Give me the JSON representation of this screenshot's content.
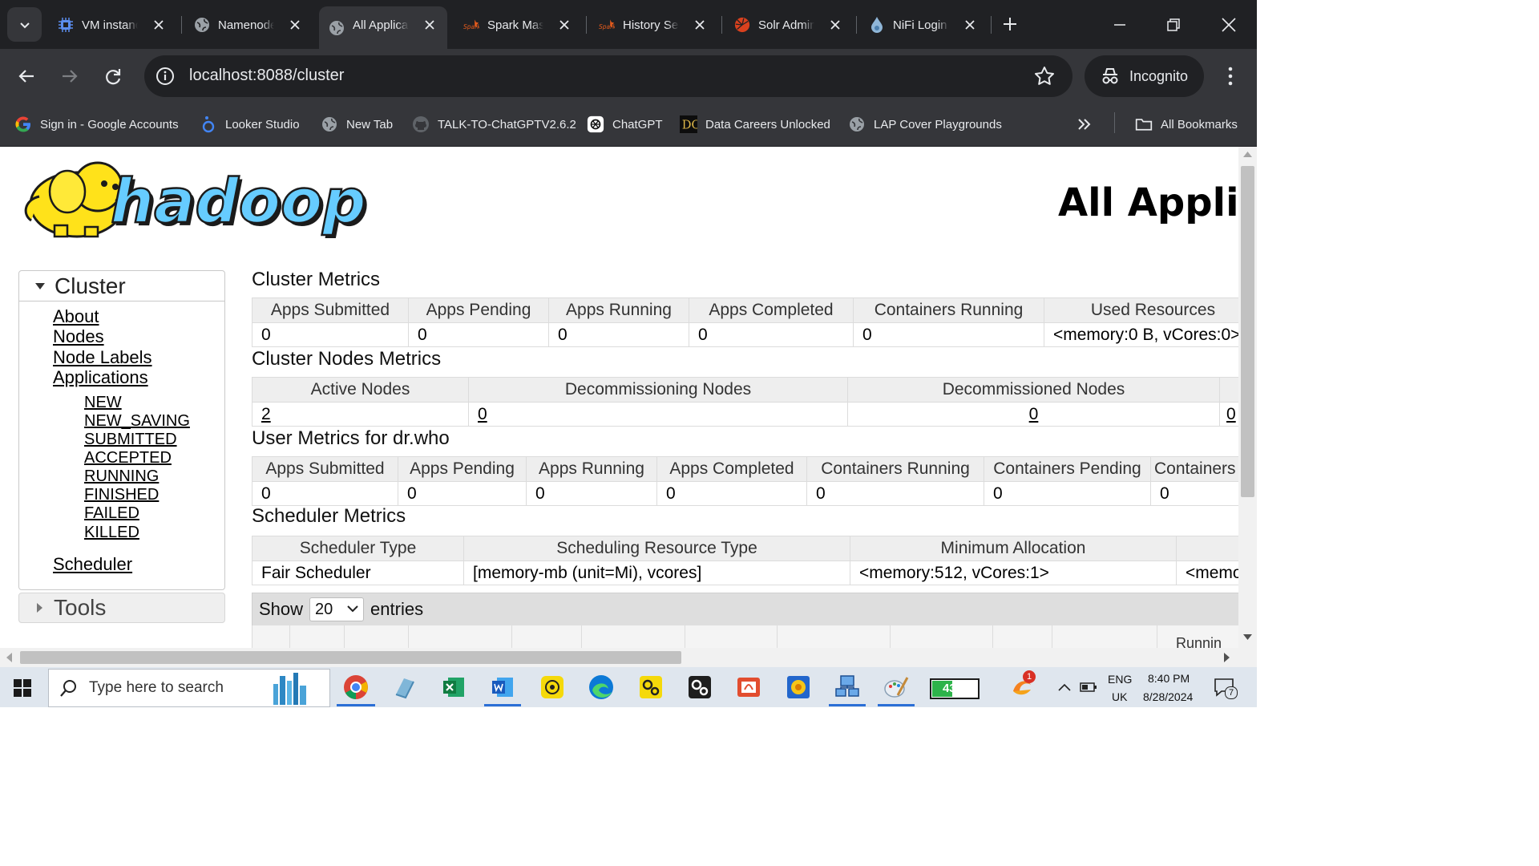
{
  "browser": {
    "tabs": [
      {
        "title": "VM instances",
        "icon": "chip-icon",
        "active": false
      },
      {
        "title": "Namenode information",
        "icon": "globe-icon",
        "active": false
      },
      {
        "title": "All Applications",
        "icon": "globe-icon",
        "active": true
      },
      {
        "title": "Spark Master",
        "icon": "spark-icon",
        "active": false
      },
      {
        "title": "History Server",
        "icon": "spark-icon",
        "active": false
      },
      {
        "title": "Solr Admin",
        "icon": "solr-icon",
        "active": false
      },
      {
        "title": "NiFi Login",
        "icon": "nifi-drop-icon",
        "active": false
      }
    ],
    "url": "localhost:8088/cluster",
    "incognito_label": "Incognito",
    "bookmarks": [
      {
        "label": "Sign in - Google Accounts",
        "icon": "google-icon"
      },
      {
        "label": "Looker Studio",
        "icon": "looker-icon"
      },
      {
        "label": "New Tab",
        "icon": "globe-icon"
      },
      {
        "label": "TALK-TO-ChatGPTV2.6.2",
        "icon": "github-icon"
      },
      {
        "label": "ChatGPT",
        "icon": "chatgpt-icon"
      },
      {
        "label": "Data Careers Unlocked",
        "icon": "dc-icon"
      },
      {
        "label": "LAP Cover Playgrounds",
        "icon": "globe-icon"
      }
    ],
    "all_bookmarks_label": "All Bookmarks"
  },
  "page": {
    "title": "All Applications",
    "nav": {
      "cluster_header": "Cluster",
      "links": [
        "About",
        "Nodes",
        "Node Labels",
        "Applications"
      ],
      "app_states": [
        "NEW",
        "NEW_SAVING",
        "SUBMITTED",
        "ACCEPTED",
        "RUNNING",
        "FINISHED",
        "FAILED",
        "KILLED"
      ],
      "scheduler_link": "Scheduler",
      "tools_header": "Tools"
    },
    "cluster_metrics": {
      "title": "Cluster Metrics",
      "headers": [
        "Apps Submitted",
        "Apps Pending",
        "Apps Running",
        "Apps Completed",
        "Containers Running",
        "Used Resources"
      ],
      "values": [
        "0",
        "0",
        "0",
        "0",
        "0",
        "<memory:0 B, vCores:0>"
      ]
    },
    "cluster_nodes_metrics": {
      "title": "Cluster Nodes Metrics",
      "headers": [
        "Active Nodes",
        "Decommissioning Nodes",
        "Decommissioned Nodes",
        ""
      ],
      "values": [
        "2",
        "0",
        "0",
        "0"
      ]
    },
    "user_metrics": {
      "title": "User Metrics for dr.who",
      "headers": [
        "Apps Submitted",
        "Apps Pending",
        "Apps Running",
        "Apps Completed",
        "Containers Running",
        "Containers Pending",
        "Containers Reserved"
      ],
      "values": [
        "0",
        "0",
        "0",
        "0",
        "0",
        "0",
        "0"
      ]
    },
    "scheduler_metrics": {
      "title": "Scheduler Metrics",
      "headers": [
        "Scheduler Type",
        "Scheduling Resource Type",
        "Minimum Allocation",
        ""
      ],
      "values": [
        "Fair Scheduler",
        "[memory-mb (unit=Mi), vcores]",
        "<memory:512, vCores:1>",
        "<memory"
      ]
    },
    "datatable": {
      "show_label": "Show",
      "entries_value": "20",
      "entries_label": "entries",
      "partial_header": "Runnin"
    }
  },
  "taskbar": {
    "search_placeholder": "Type here to search",
    "battery_percent": "43%",
    "battery_level": 0.43,
    "notification_badge": "1",
    "language": "ENG",
    "region": "UK",
    "time": "8:40 PM",
    "date": "8/28/2024",
    "notif_count": "7"
  }
}
